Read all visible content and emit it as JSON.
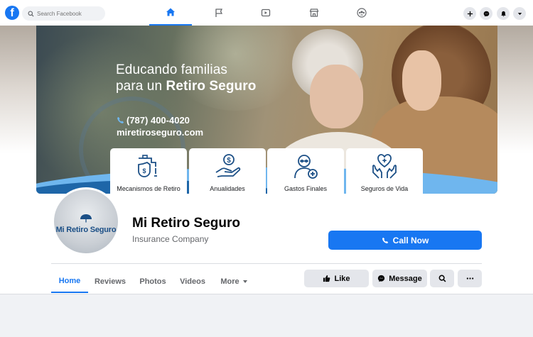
{
  "search": {
    "placeholder": "Search Facebook"
  },
  "cover": {
    "headline_line1": "Educando familias",
    "headline_line2_prefix": "para un ",
    "headline_line2_bold": "Retiro Seguro",
    "phone": "(787) 400-4020",
    "website": "miretiroseguro.com",
    "services": [
      {
        "label": "Mecanismos de Retiro",
        "icon": "piggy-bank-faucet-icon"
      },
      {
        "label": "Anualidades",
        "icon": "hand-coin-icon"
      },
      {
        "label": "Gastos Finales",
        "icon": "elder-plus-icon"
      },
      {
        "label": "Seguros de Vida",
        "icon": "hands-heart-icon"
      }
    ]
  },
  "profile": {
    "avatar_text": "Mi Retiro Seguro",
    "name": "Mi Retiro Seguro",
    "category": "Insurance Company",
    "call_button": "Call Now"
  },
  "tabs": [
    "Home",
    "Reviews",
    "Photos",
    "Videos",
    "More"
  ],
  "actions": {
    "like": "Like",
    "message": "Message"
  },
  "colors": {
    "brand": "#1877f2",
    "accent_light": "#6fb6ee",
    "dark_blue": "#1b4f86"
  }
}
